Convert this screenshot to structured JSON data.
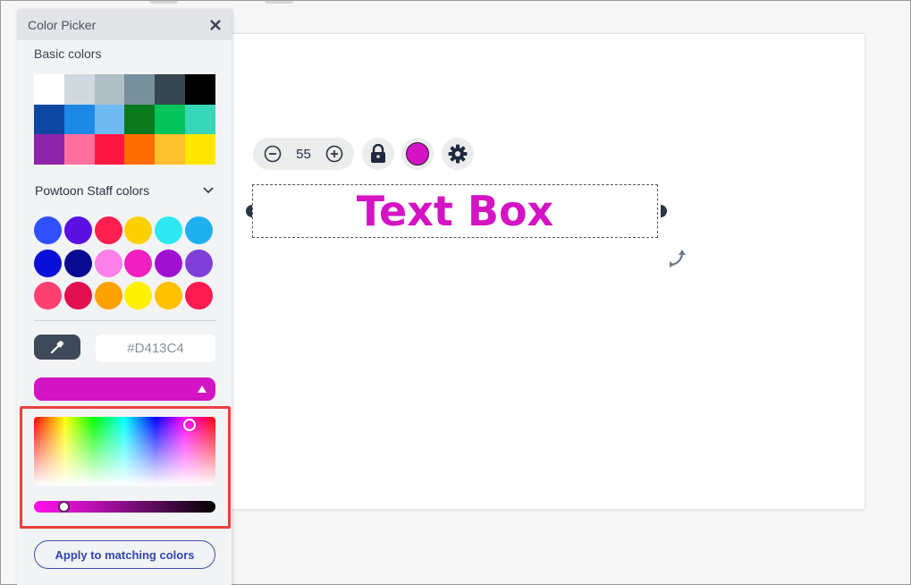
{
  "panel": {
    "title": "Color Picker",
    "basic_colors_label": "Basic colors",
    "basic_colors": [
      "#ffffff",
      "#cfd8dc",
      "#b0bec5",
      "#78909c",
      "#37474f",
      "#000000",
      "#0d47a1",
      "#1e88e5",
      "#6ebaf0",
      "#0b7a1f",
      "#02c45a",
      "#36d6b6",
      "#8e24aa",
      "#ff6f9e",
      "#ff1744",
      "#ff6d00",
      "#fbc02d",
      "#ffe600"
    ],
    "staff_colors_label": "Powtoon Staff colors",
    "staff_colors": [
      "#3050ff",
      "#5a10e0",
      "#ff1f50",
      "#ffd000",
      "#2ee8f0",
      "#20b0f0",
      "#0a10d8",
      "#0a0a90",
      "#ff80e8",
      "#f020c0",
      "#a010d0",
      "#8040d8",
      "#ff4070",
      "#e01050",
      "#ffa200",
      "#fff000",
      "#ffc000",
      "#ff1a50"
    ],
    "hex_value": "#D413C4",
    "current_color": "#D413C4",
    "apply_label": "Apply to matching colors"
  },
  "toolbar": {
    "zoom_value": "55",
    "color": "#D413C4"
  },
  "textbox": {
    "text": "Text Box",
    "color": "#D413C4"
  },
  "colors": {
    "highlight": "#e8403e",
    "accent": "#3046b0"
  }
}
